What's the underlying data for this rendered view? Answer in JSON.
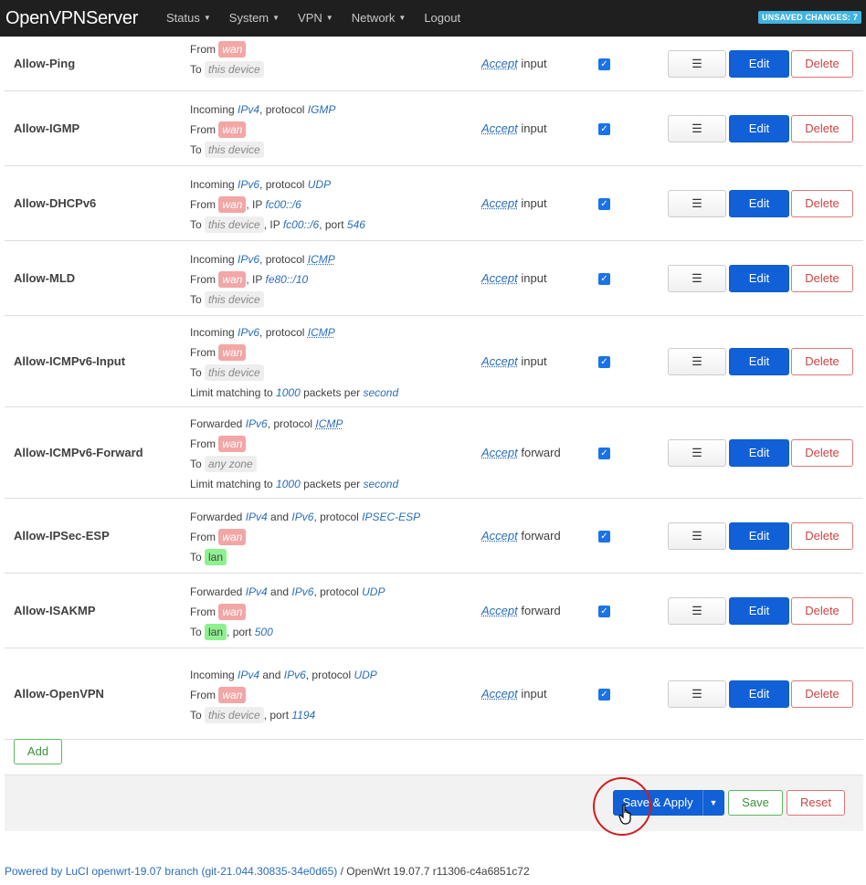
{
  "app": {
    "title": "OpenVPNServer",
    "menu": [
      "Status",
      "System",
      "VPN",
      "Network",
      "Logout"
    ],
    "unsaved_badge": "UNSAVED CHANGES: 7"
  },
  "rules": [
    {
      "name": "Allow-Ping",
      "lines": [
        [
          {
            "t": "From "
          },
          {
            "z": "wan",
            "k": "wan"
          }
        ],
        [
          {
            "t": "To "
          },
          {
            "z": "this device",
            "k": "dev"
          }
        ]
      ],
      "action": "Accept",
      "action_tail": " input"
    },
    {
      "name": "Allow-IGMP",
      "lines": [
        [
          {
            "t": "Incoming "
          },
          {
            "h": "IPv4"
          },
          {
            "t": ", protocol "
          },
          {
            "h": "IGMP"
          }
        ],
        [
          {
            "t": "From "
          },
          {
            "z": "wan",
            "k": "wan"
          }
        ],
        [
          {
            "t": "To "
          },
          {
            "z": "this device",
            "k": "dev"
          }
        ]
      ],
      "action": "Accept",
      "action_tail": " input"
    },
    {
      "name": "Allow-DHCPv6",
      "lines": [
        [
          {
            "t": "Incoming "
          },
          {
            "h": "IPv6"
          },
          {
            "t": ", protocol "
          },
          {
            "h": "UDP"
          }
        ],
        [
          {
            "t": "From "
          },
          {
            "z": "wan",
            "k": "wan"
          },
          {
            "t": ", IP "
          },
          {
            "h": "fc00::/6"
          }
        ],
        [
          {
            "t": "To "
          },
          {
            "z": "this device",
            "k": "dev"
          },
          {
            "t": ", IP "
          },
          {
            "h": "fc00::/6"
          },
          {
            "t": ", port "
          },
          {
            "h": "546"
          }
        ]
      ],
      "action": "Accept",
      "action_tail": " input"
    },
    {
      "name": "Allow-MLD",
      "lines": [
        [
          {
            "t": "Incoming "
          },
          {
            "h": "IPv6"
          },
          {
            "t": ", protocol "
          },
          {
            "hu": "ICMP"
          }
        ],
        [
          {
            "t": "From "
          },
          {
            "z": "wan",
            "k": "wan"
          },
          {
            "t": ", IP "
          },
          {
            "h": "fe80::/10"
          }
        ],
        [
          {
            "t": "To "
          },
          {
            "z": "this device",
            "k": "dev"
          }
        ]
      ],
      "action": "Accept",
      "action_tail": " input"
    },
    {
      "name": "Allow-ICMPv6-Input",
      "lines": [
        [
          {
            "t": "Incoming "
          },
          {
            "h": "IPv6"
          },
          {
            "t": ", protocol "
          },
          {
            "hu": "ICMP"
          }
        ],
        [
          {
            "t": "From "
          },
          {
            "z": "wan",
            "k": "wan"
          }
        ],
        [
          {
            "t": "To "
          },
          {
            "z": "this device",
            "k": "dev"
          }
        ],
        [
          {
            "t": "Limit matching to "
          },
          {
            "h": "1000"
          },
          {
            "t": " packets per "
          },
          {
            "h": "second"
          }
        ]
      ],
      "action": "Accept",
      "action_tail": " input"
    },
    {
      "name": "Allow-ICMPv6-Forward",
      "lines": [
        [
          {
            "t": "Forwarded "
          },
          {
            "h": "IPv6"
          },
          {
            "t": ", protocol "
          },
          {
            "hu": "ICMP"
          }
        ],
        [
          {
            "t": "From "
          },
          {
            "z": "wan",
            "k": "wan"
          }
        ],
        [
          {
            "t": "To "
          },
          {
            "z": "any zone",
            "k": "dev"
          }
        ],
        [
          {
            "t": "Limit matching to "
          },
          {
            "h": "1000"
          },
          {
            "t": " packets per "
          },
          {
            "h": "second"
          }
        ]
      ],
      "action": "Accept",
      "action_tail": " forward"
    },
    {
      "name": "Allow-IPSec-ESP",
      "lines": [
        [
          {
            "t": "Forwarded "
          },
          {
            "h": "IPv4"
          },
          {
            "t": " and "
          },
          {
            "h": "IPv6"
          },
          {
            "t": ", protocol "
          },
          {
            "h": "IPSEC-ESP"
          }
        ],
        [
          {
            "t": "From "
          },
          {
            "z": "wan",
            "k": "wan"
          }
        ],
        [
          {
            "t": "To "
          },
          {
            "z": "lan",
            "k": "lan"
          }
        ]
      ],
      "action": "Accept",
      "action_tail": " forward"
    },
    {
      "name": "Allow-ISAKMP",
      "lines": [
        [
          {
            "t": "Forwarded "
          },
          {
            "h": "IPv4"
          },
          {
            "t": " and "
          },
          {
            "h": "IPv6"
          },
          {
            "t": ", protocol "
          },
          {
            "h": "UDP"
          }
        ],
        [
          {
            "t": "From "
          },
          {
            "z": "wan",
            "k": "wan"
          }
        ],
        [
          {
            "t": "To "
          },
          {
            "z": "lan",
            "k": "lan"
          },
          {
            "t": ", port "
          },
          {
            "h": "500"
          }
        ]
      ],
      "action": "Accept",
      "action_tail": " forward"
    },
    {
      "name": "Allow-OpenVPN",
      "lines": [
        [
          {
            "t": "Incoming "
          },
          {
            "h": "IPv4"
          },
          {
            "t": " and "
          },
          {
            "h": "IPv6"
          },
          {
            "t": ", protocol "
          },
          {
            "h": "UDP"
          }
        ],
        [
          {
            "t": "From "
          },
          {
            "z": "wan",
            "k": "wan"
          }
        ],
        [
          {
            "t": "To "
          },
          {
            "z": "this device",
            "k": "dev"
          },
          {
            "t": ", port "
          },
          {
            "h": "1194"
          }
        ]
      ],
      "action": "Accept",
      "action_tail": " input"
    }
  ],
  "buttons": {
    "menu_glyph": "☰",
    "edit": "Edit",
    "delete": "Delete",
    "add": "Add",
    "save_apply": "Save & Apply",
    "save": "Save",
    "reset": "Reset"
  },
  "footer": {
    "link": "Powered by LuCI openwrt-19.07 branch (git-21.044.30835-34e0d65)",
    "tail": " / OpenWrt 19.07.7 r11306-c4a6851c72"
  }
}
